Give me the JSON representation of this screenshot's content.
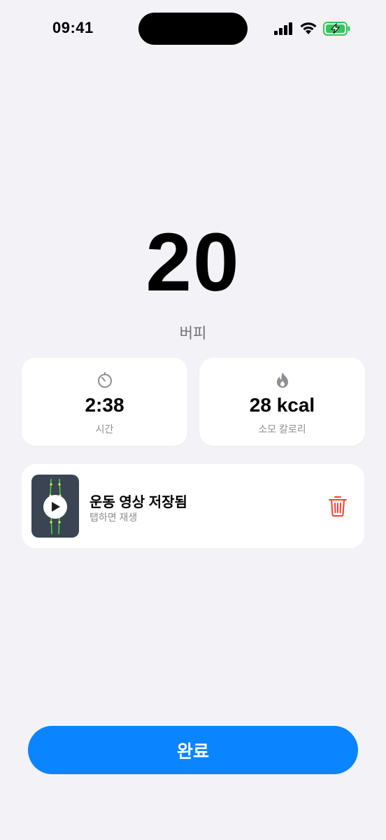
{
  "status_bar": {
    "time": "09:41",
    "icons": [
      "signal-icon",
      "wifi-icon",
      "battery-charging-icon"
    ],
    "battery_color": "#34c759"
  },
  "workout": {
    "rep_count": "20",
    "exercise_name": "버피"
  },
  "stats": {
    "time": {
      "icon": "timer-icon",
      "value": "2:38",
      "label": "시간"
    },
    "calories": {
      "icon": "flame-icon",
      "value": "28 kcal",
      "label": "소모 칼로리"
    }
  },
  "video": {
    "title": "운동 영상 저장됨",
    "subtitle": "탭하면 재생",
    "thumbnail_icon": "play-icon",
    "delete_icon": "trash-icon",
    "delete_color": "#ff3b30"
  },
  "done_button": {
    "label": "완료",
    "color": "#0a84ff"
  }
}
